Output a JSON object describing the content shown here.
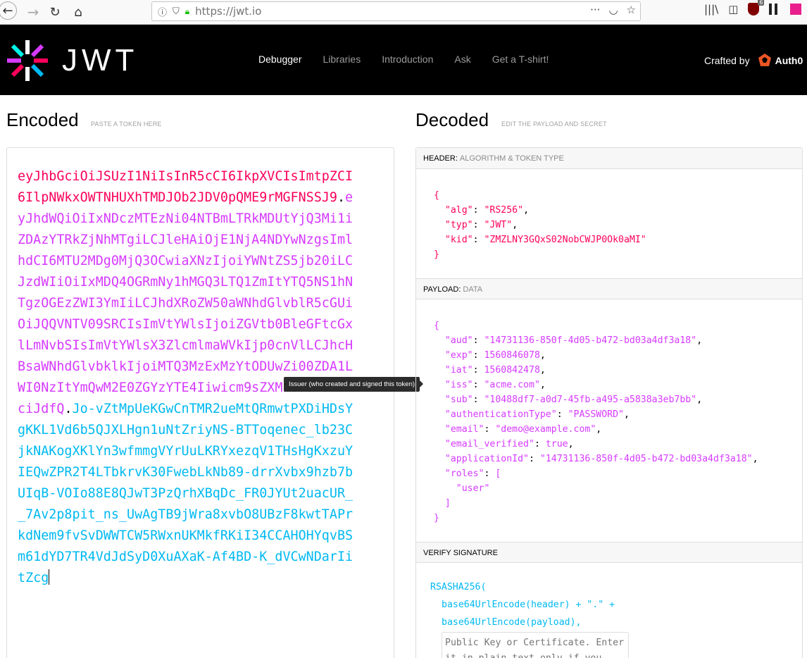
{
  "browser": {
    "url": "https://jwt.io",
    "extension_badge": "6"
  },
  "header": {
    "logo_text": "JWT",
    "nav": [
      "Debugger",
      "Libraries",
      "Introduction",
      "Ask",
      "Get a T-shirt!"
    ],
    "active_nav": "Debugger",
    "crafted_by": "Crafted by",
    "auth0": "Auth0"
  },
  "encoded": {
    "title": "Encoded",
    "subtitle": "PASTE A TOKEN HERE",
    "token_header": "eyJhbGciOiJSUzI1NiIsInR5cCI6IkpXVCIsImtpZCI6IlpNWkxOWTNHUXhTMDJOb2JDV0pQME9rMGFNSSJ9",
    "token_payload": "eyJhdWQiOiIxNDczMTEzNi04NTBmLTRkMDUtYjQ3Mi1iZDAzYTRkZjNhMTgiLCJleHAiOjE1NjA4NDYwNzgsImlhdCI6MTU2MDg0MjQ3OCwiaXNzIjoiYWNtZS5jb20iLCJzdWIiOiIxMDQ4OGRmNy1hMGQ3LTQ1ZmItYTQ5NS1hNTgzOGEzZWI3YmIiLCJhdXRoZW50aWNhdGlvblR5cGUiOiJQQVNTV09SRCIsImVtYWlsIjoiZGVtb0BleGFtcGxlLmNvbSIsImVtYWlsX3ZlcmlmaWVkIjp0cnVlLCJhcHBsaWNhdGlvbklkIjoiMTQ3MzExMzYtODUwZi00ZDA1LWI0NzItYmQwM2E0ZGYzYTE4Iiwicm9sZXMiOlsidXNlciJdfQ",
    "token_signature": "Jo-vZtMpUeKGwCnTMR2ueMtQRmwtPXDiHDsYgKKL1Vd6b5QJXLHgn1uNtZriyNS-BTToqenec_lb23CjkNAKogXKlYn3wfmmgVYrUuLKRYxezqV1THsHgKxzuYIEQwZPR2T4LTbkrvK30FwebLkNb89-drrXvbx9hzb7bUIqB-VOIo88E8QJwT3PzQrhXBqDc_FR0JYUt2uacUR__7Av2p8pit_ns_UwAgTB9jWra8xvbO8UBzF8kwtTAPrkdNem9fvSvDWWTCW5RWxnUKMkfRKiI34CCAHOHYqvBSm61dYD7TR4VdJdSyD0XuAXaK-Af4BD-K_dVCwNDarIitZcg",
    "tooltip": "Issuer (who created and signed this token)"
  },
  "decoded": {
    "title": "Decoded",
    "subtitle": "EDIT THE PAYLOAD AND SECRET",
    "header_label": "HEADER:",
    "header_sub": "ALGORITHM & TOKEN TYPE",
    "header_json": [
      [
        "alg",
        "\"RS256\""
      ],
      [
        "typ",
        "\"JWT\""
      ],
      [
        "kid",
        "\"ZMZLNY3GQxS02NobCWJP0Ok0aMI\""
      ]
    ],
    "payload_label": "PAYLOAD:",
    "payload_sub": "DATA",
    "payload_json": [
      [
        "aud",
        "\"14731136-850f-4d05-b472-bd03a4df3a18\""
      ],
      [
        "exp",
        "1560846078"
      ],
      [
        "iat",
        "1560842478"
      ],
      [
        "iss",
        "\"acme.com\""
      ],
      [
        "sub",
        "\"10488df7-a0d7-45fb-a495-a5838a3eb7bb\""
      ],
      [
        "authenticationType",
        "\"PASSWORD\""
      ],
      [
        "email",
        "\"demo@example.com\""
      ],
      [
        "email_verified",
        "true"
      ],
      [
        "applicationId",
        "\"14731136-850f-4d05-b472-bd03a4df3a18\""
      ]
    ],
    "roles_key": "roles",
    "roles": [
      "\"user\""
    ],
    "verify_label": "VERIFY SIGNATURE",
    "sig_func": "RSASHA256(",
    "sig_line1": "base64UrlEncode(header) + \".\" +",
    "sig_line2": "base64UrlEncode(payload),",
    "pubkey_placeholder": "Public Key or Certificate. Enter it in plain text only if you want to verify a token"
  },
  "colors": {
    "header": "#fb015b",
    "payload": "#d63aff",
    "signature": "#00b9f1"
  }
}
